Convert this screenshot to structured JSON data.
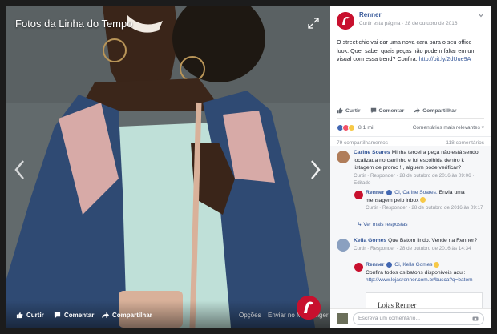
{
  "viewer": {
    "title": "Fotos da Linha do Tempo",
    "bottom_bar": {
      "like": "Curtir",
      "comment": "Comentar",
      "share": "Compartilhar",
      "options": "Opções",
      "messenger": "Enviar no Messenger"
    }
  },
  "post": {
    "page_name": "Renner",
    "follow": "Curtir esta página",
    "date": "28 de outubro de 2016",
    "text": "O street chic vai dar uma nova cara para o seu office look. Quer saber quais peças não podem faltar em um visual com essa trend? Confira:",
    "link": "http://bit.ly/2dUue9A",
    "actions": {
      "like": "Curtir",
      "comment": "Comentar",
      "share": "Compartilhar"
    },
    "reactions_count": "8,1 mil",
    "sort_label": "Comentários mais relevantes",
    "shares": "79 compartilhamentos",
    "comments_count": "118 comentários"
  },
  "comments": [
    {
      "name": "Carine Soares",
      "text": "Minha terceira peça não está sendo localizada no carrinho e foi escolhida dentro k listagem de promo !!, alguém pode verificar?",
      "meta": "Curtir · Responder · 28 de outubro de 2016 às 09:06 · Editado"
    },
    {
      "name": "Renner",
      "mention": "Oi, Carine Soares.",
      "text": "Envia uma mensagem pelo inbox",
      "meta": "Curtir · Responder · 28 de outubro de 2016 às 09:17",
      "more_replies": "Ver mais respostas"
    },
    {
      "name": "Kella Gomes",
      "text": "Que Batom lindo. Vende na Renner?",
      "meta": "Curtir · Responder · 28 de outubro de 2016 às 14:34"
    },
    {
      "name": "Renner",
      "mention": "Oi, Kella Gomes",
      "text": "Confira todos os batons disponíveis aqui:",
      "link": "http://www.lojasrenner.com.br/busca?q=batom",
      "preview_title": "Lojas Renner"
    }
  ],
  "comment_input": {
    "placeholder": "Escreva um comentário..."
  },
  "colors": {
    "brand_red": "#c8102e",
    "facebook_blue": "#365899",
    "jacket_navy": "#2f4a73",
    "jacket_pink": "#d7aaa7"
  }
}
